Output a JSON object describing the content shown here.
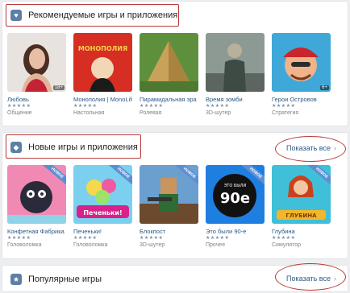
{
  "sections": [
    {
      "title": "Рекомендуемые игры и приложения",
      "icon": "heart-icon",
      "show_all": "",
      "apps": [
        {
          "name": "Любовь",
          "genre": "Общение",
          "stars": "★★★★★",
          "age": "18+",
          "badge": ""
        },
        {
          "name": "Монополия | MonoLife",
          "genre": "Настольная",
          "stars": "★★★★★",
          "age": "",
          "badge": ""
        },
        {
          "name": "Пирамидальная эра",
          "genre": "Ролевая",
          "stars": "★★★★★",
          "age": "",
          "badge": ""
        },
        {
          "name": "Время зомби",
          "genre": "3D-шутер",
          "stars": "★★★★★",
          "age": "",
          "badge": ""
        },
        {
          "name": "Герои Островов",
          "genre": "Стратегия",
          "stars": "★★★★★",
          "age": "6+",
          "badge": ""
        }
      ]
    },
    {
      "title": "Новые игры и приложения",
      "icon": "tag-icon",
      "show_all": "Показать все",
      "apps": [
        {
          "name": "Конфетная Фабрика",
          "genre": "Головоломка",
          "stars": "★★★★★",
          "age": "",
          "badge": "НОВОЕ"
        },
        {
          "name": "Печеньки!",
          "genre": "Головоломка",
          "stars": "★★★★★",
          "age": "",
          "badge": "НОВОЕ"
        },
        {
          "name": "Блокпост",
          "genre": "3D-шутер",
          "stars": "★★★★★",
          "age": "",
          "badge": "НОВОЕ"
        },
        {
          "name": "Это были 90-е",
          "genre": "Прочее",
          "stars": "★★★★★",
          "age": "",
          "badge": "НОВОЕ"
        },
        {
          "name": "Глубина",
          "genre": "Симулятор",
          "stars": "★★★★★",
          "age": "",
          "badge": "НОВОЕ"
        }
      ]
    },
    {
      "title": "Популярные игры",
      "icon": "star-icon",
      "show_all": "Показать все",
      "apps": []
    }
  ],
  "thumb_texts": {
    "monopoly": "МОНОПОЛИЯ",
    "cookies": "Печеньки!",
    "nineties_small": "ЭТО БЫЛИ",
    "nineties_big": "90е",
    "depth": "ГЛУБИНА"
  },
  "colors": {
    "accent_link": "#2a5885",
    "highlight": "#b73a3a",
    "section_icon": "#5d7fa6"
  }
}
